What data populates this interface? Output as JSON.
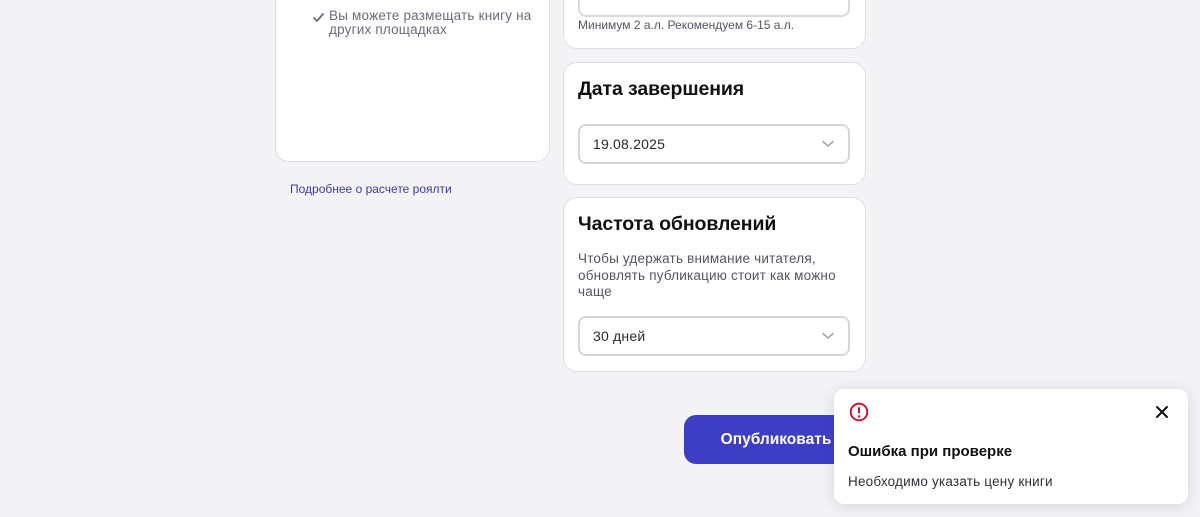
{
  "left_panel": {
    "benefit_text": "Вы можете размещать книгу на других площадках",
    "royalty_link": "Подробнее о расчете роялти"
  },
  "volume": {
    "hint": "Минимум 2 а.л. Рекомендуем 6-15 а.л."
  },
  "completion_date": {
    "title": "Дата завершения",
    "value": "19.08.2025"
  },
  "update_frequency": {
    "title": "Частота обновлений",
    "description": "Чтобы удержать внимание читателя, обновлять публикацию стоит как можно чаще",
    "value": "30 дней"
  },
  "publish_button": {
    "label": "Опубликовать"
  },
  "toast": {
    "title": "Ошибка при проверке",
    "message": "Необходимо указать цену книги"
  },
  "colors": {
    "accent": "#3d3ec5",
    "error": "#c8102e",
    "background": "#f3f3f6"
  },
  "icons": {
    "check": "check-icon",
    "chevron": "chevron-down-icon",
    "alert": "alert-circle-icon",
    "close": "close-icon"
  }
}
